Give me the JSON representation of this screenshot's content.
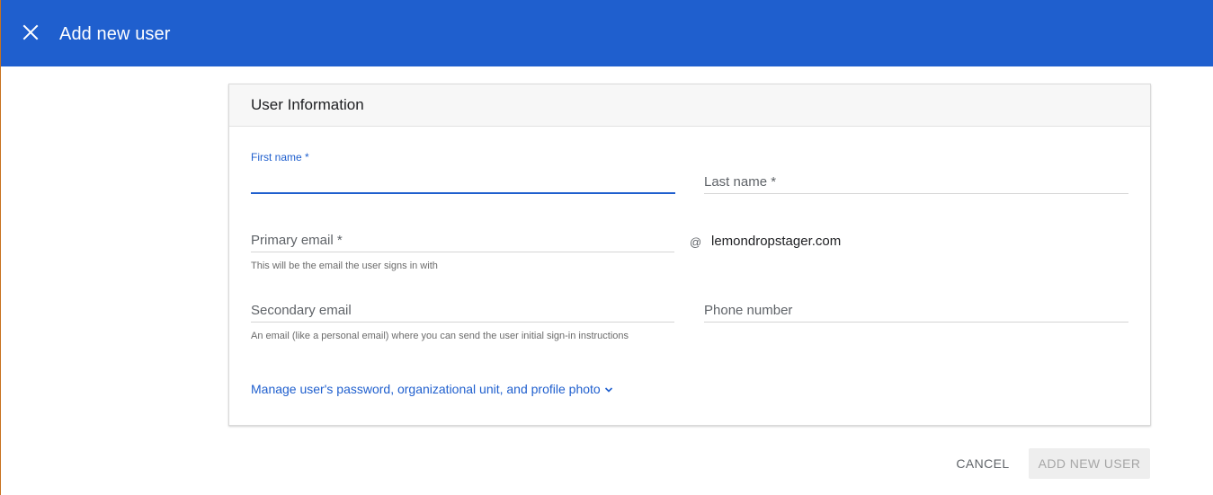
{
  "header": {
    "title": "Add new user",
    "close_icon": "close-icon",
    "background_color": "#1f5fce"
  },
  "card": {
    "title": "User Information",
    "first_name": {
      "label": "First name *",
      "value": "",
      "focused": true
    },
    "last_name": {
      "label": "Last name *",
      "value": ""
    },
    "primary_email": {
      "label": "Primary email *",
      "value": "",
      "helper": "This will be the email the user signs in with",
      "at": "@",
      "domain": "lemondropstager.com"
    },
    "secondary_email": {
      "label": "Secondary email",
      "value": "",
      "helper": "An email (like a personal email) where you can send the user initial sign-in instructions"
    },
    "phone": {
      "label": "Phone number",
      "value": ""
    },
    "manage_link": {
      "label": "Manage user's password, organizational unit, and profile photo",
      "icon": "chevron-down-icon"
    }
  },
  "actions": {
    "cancel_label": "CANCEL",
    "add_label": "ADD NEW USER",
    "add_disabled": true
  }
}
